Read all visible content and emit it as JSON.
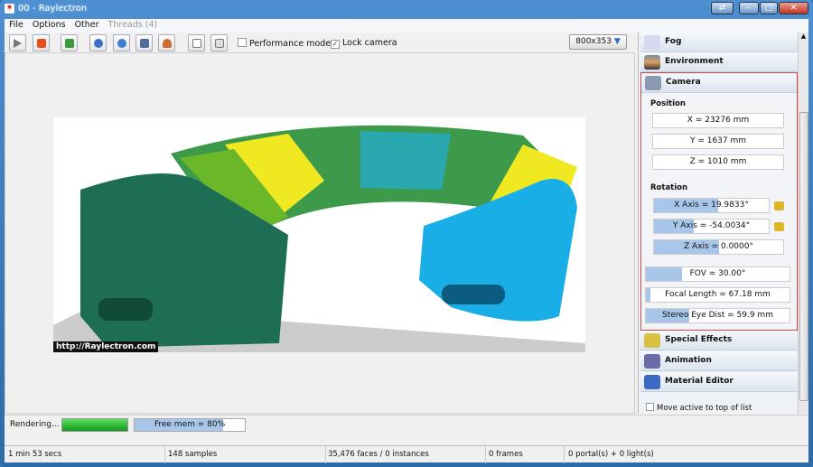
{
  "window": {
    "title": "00 - Raylectron"
  },
  "menu": [
    "File",
    "Options",
    "Other",
    "Threads (4)"
  ],
  "toolbar": {
    "performance_mode": "Performance mode",
    "performance_checked": false,
    "lock_camera": "Lock camera",
    "lock_checked": true,
    "resolution": "800x353"
  },
  "viewport": {
    "watermark": "http://Raylectron.com"
  },
  "panel": {
    "sections_top": [
      "Fog",
      "Environment",
      "Camera"
    ],
    "position_label": "Position",
    "position": [
      "X = 23276 mm",
      "Y = 1637 mm",
      "Z = 1010 mm"
    ],
    "rotation_label": "Rotation",
    "rotation": [
      {
        "label": "X Axis = 19.9833°",
        "level": 0.56
      },
      {
        "label": "Y Axis = -54.0034°",
        "level": 0.35
      },
      {
        "label": "Z Axis = 0.0000°",
        "level": 0.5
      }
    ],
    "lens": [
      {
        "label": "FOV = 30.00°",
        "level": 0.25
      },
      {
        "label": "Focal Length = 67.18 mm",
        "level": 0.03
      },
      {
        "label": "Stereo Eye Dist = 59.9 mm",
        "level": 0.3
      }
    ],
    "sections_bottom": [
      "Special Effects",
      "Animation",
      "Material Editor"
    ],
    "move_active": "Move active to top of list"
  },
  "status": {
    "rendering": "Rendering...",
    "progress": 1.0,
    "free_mem": "Free mem = 80%",
    "free_mem_level": 0.8
  },
  "bottom": {
    "time": "1 min  53 secs",
    "samples": "148 samples",
    "faces": "35,476 faces / 0 instances",
    "frames": "0 frames",
    "portals": "0 portal(s)  +  0 light(s)"
  },
  "colors": {
    "accent": "#a7c6ea",
    "camera_border": "#d04848",
    "progress": "#1dbb2a"
  }
}
